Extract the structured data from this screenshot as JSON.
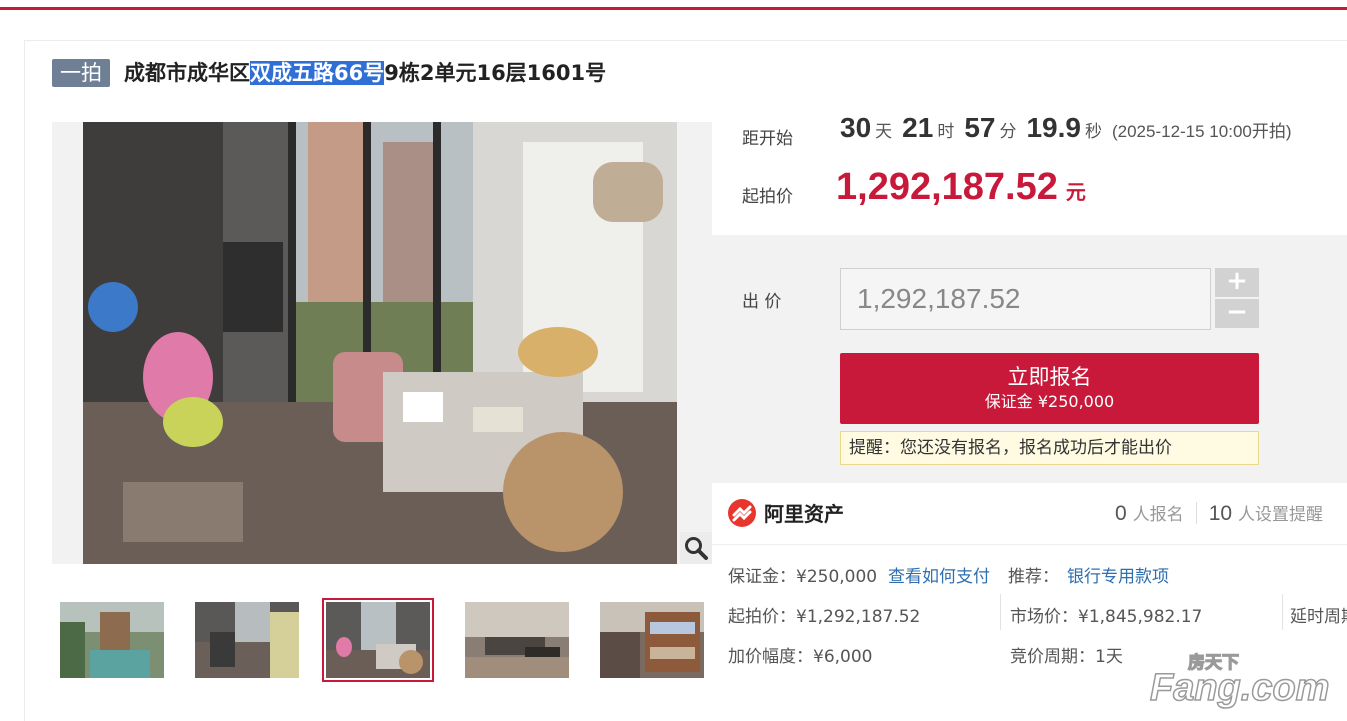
{
  "header": {
    "tag": "一拍",
    "title_prefix": "成都市成华区",
    "title_highlight": "双成五路66号",
    "title_suffix": "9栋2单元16层1601号"
  },
  "countdown": {
    "label": "距开始",
    "days": "30",
    "days_unit": "天",
    "hours": "21",
    "hours_unit": "时",
    "minutes": "57",
    "minutes_unit": "分",
    "seconds": "19.9",
    "seconds_unit": "秒",
    "start_time": "(2025-12-15 10:00开拍)"
  },
  "start_price": {
    "label": "起拍价",
    "value": "1,292,187.52",
    "unit": "元"
  },
  "bid": {
    "label": "出 价",
    "placeholder": "1,292,187.52",
    "plus": "+",
    "minus": "−"
  },
  "signup": {
    "label": "立即报名",
    "deposit": "保证金 ¥250,000"
  },
  "notice": "提醒：您还没有报名，报名成功后才能出价",
  "brand": {
    "name": "阿里资产",
    "color": "#e8362d"
  },
  "stats": {
    "signups": "0",
    "signups_label": "人报名",
    "reminders": "10",
    "reminders_label": "人设置提醒"
  },
  "info": {
    "deposit": "保证金：¥250,000",
    "how_to_pay": "查看如何支付",
    "recommend_label": "推荐：",
    "recommend_link": "银行专用款项",
    "start_price": "起拍价：¥1,292,187.52",
    "market_price": "市场价：¥1,845,982.17",
    "delay": "延时周期",
    "increment": "加价幅度：¥6,000",
    "cycle": "竞价周期：1天"
  },
  "thumbnails": [
    {
      "label": "garden"
    },
    {
      "label": "room-1"
    },
    {
      "label": "room-2",
      "active": true
    },
    {
      "label": "living-room"
    },
    {
      "label": "bunk-bed-room"
    }
  ],
  "watermark": {
    "small": "房天下",
    "big": "Fang.com"
  },
  "colors": {
    "accent": "#c8193a",
    "link": "#2f6fb0",
    "tag_bg": "#6f7f95",
    "highlight": "#2f6fd6"
  }
}
